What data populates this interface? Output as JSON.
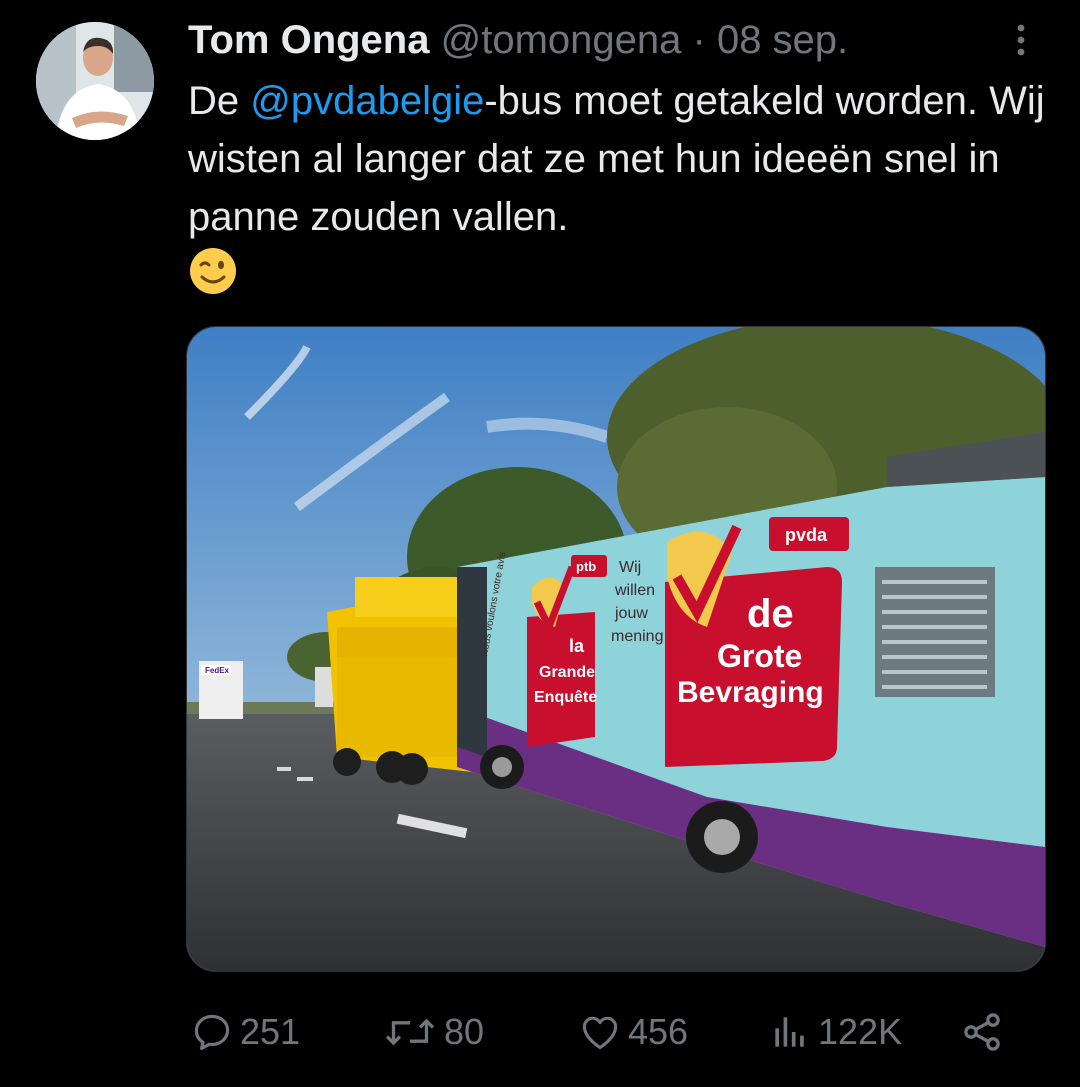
{
  "author": {
    "name": "Tom Ongena",
    "handle": "@tomongena",
    "separator": "·",
    "date": "08 sep."
  },
  "tweet": {
    "text_before": "De ",
    "mention": "@pvdabelgie",
    "text_after": "-bus moet getakeld worden. Wij wisten al langer dat ze met hun ideeën snel in panne zouden vallen.",
    "emoji": "winking-face"
  },
  "media": {
    "bus_text_fr_brand": "ptb",
    "bus_text_fr_small": "Nous voulons votre avis",
    "bus_text_fr": [
      "la",
      "Grande",
      "Enquête"
    ],
    "bus_text_nl_small": [
      "Wij",
      "willen",
      "jouw",
      "mening"
    ],
    "bus_text_nl": [
      "de",
      "Grote",
      "Bevraging"
    ],
    "bus_text_nl_brand": "pvda",
    "truck_label": "FedEx"
  },
  "actions": {
    "replies": "251",
    "retweets": "80",
    "likes": "456",
    "views": "122K"
  },
  "colors": {
    "background": "#000000",
    "text": "#e7e9ea",
    "muted": "#71767b",
    "accent": "#1d9bf0"
  }
}
